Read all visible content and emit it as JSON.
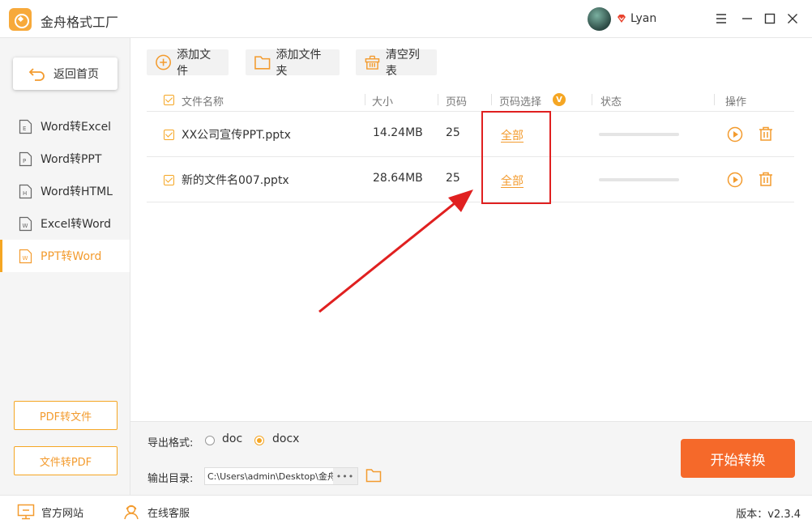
{
  "app": {
    "title": "金舟格式工厂",
    "username": "Lyan"
  },
  "colors": {
    "accent": "#f5a623",
    "start": "#f5692a",
    "highlight": "#e02020"
  },
  "sidebar": {
    "back_label": "返回首页",
    "items": [
      {
        "label": "Word转Excel",
        "active": false
      },
      {
        "label": "Word转PPT",
        "active": false
      },
      {
        "label": "Word转HTML",
        "active": false
      },
      {
        "label": "Excel转Word",
        "active": false
      },
      {
        "label": "PPT转Word",
        "active": true
      }
    ],
    "pdf_to_file": "PDF转文件",
    "file_to_pdf": "文件转PDF"
  },
  "toolbar": {
    "add_file": "添加文件",
    "add_folder": "添加文件夹",
    "clear_list": "清空列表"
  },
  "table": {
    "headers": {
      "name": "文件名称",
      "size": "大小",
      "pages": "页码",
      "page_select": "页码选择",
      "vip_badge": "V",
      "status": "状态",
      "actions": "操作"
    },
    "rows": [
      {
        "name": "XX公司宣传PPT.pptx",
        "size": "14.24MB",
        "pages": "25",
        "page_select": "全部",
        "progress": 0
      },
      {
        "name": "新的文件名007.pptx",
        "size": "28.64MB",
        "pages": "25",
        "page_select": "全部",
        "progress": 0
      }
    ]
  },
  "bottom": {
    "format_label": "导出格式:",
    "format_options": [
      "doc",
      "docx"
    ],
    "selected_format": "docx",
    "output_label": "输出目录:",
    "output_path": "C:\\Users\\admin\\Desktop\\金舟格式工厂",
    "more": "•••",
    "start_button": "开始转换"
  },
  "footer": {
    "website": "官方网站",
    "support": "在线客服",
    "version": "版本：v2.3.4"
  }
}
